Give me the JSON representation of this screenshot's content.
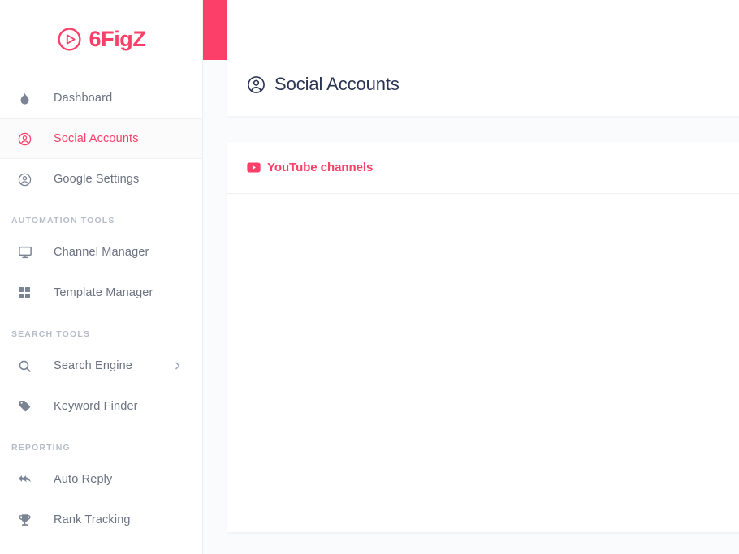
{
  "brand": {
    "name": "6FigZ",
    "logo_icon": "play-circle-icon"
  },
  "colors": {
    "accent": "#fb3f68",
    "title_text": "#2b3553",
    "nav_text": "#6b7280",
    "section_text": "#b6bcc7",
    "page_bg": "#fafbfc"
  },
  "topbar": {
    "menu_icon": "hamburger-icon"
  },
  "sidebar": {
    "groups": [
      {
        "section": null,
        "items": [
          {
            "label": "Dashboard",
            "icon": "flame-icon",
            "active": false,
            "has_arrow": false
          },
          {
            "label": "Social Accounts",
            "icon": "user-circle-icon",
            "active": true,
            "has_arrow": false
          },
          {
            "label": "Google Settings",
            "icon": "user-circle-icon",
            "active": false,
            "has_arrow": false
          }
        ]
      },
      {
        "section": "AUTOMATION TOOLS",
        "items": [
          {
            "label": "Channel Manager",
            "icon": "monitor-icon",
            "active": false,
            "has_arrow": false
          },
          {
            "label": "Template Manager",
            "icon": "grid-icon",
            "active": false,
            "has_arrow": false
          }
        ]
      },
      {
        "section": "SEARCH TOOLS",
        "items": [
          {
            "label": "Search Engine",
            "icon": "search-icon",
            "active": false,
            "has_arrow": true
          },
          {
            "label": "Keyword Finder",
            "icon": "tag-icon",
            "active": false,
            "has_arrow": false
          }
        ]
      },
      {
        "section": "REPORTING",
        "items": [
          {
            "label": "Auto Reply",
            "icon": "reply-all-icon",
            "active": false,
            "has_arrow": false
          },
          {
            "label": "Rank Tracking",
            "icon": "trophy-icon",
            "active": false,
            "has_arrow": false
          }
        ]
      }
    ]
  },
  "main": {
    "page_title": "Social Accounts",
    "page_title_icon": "user-circle-icon",
    "tabs": [
      {
        "label": "YouTube channels",
        "icon": "youtube-icon",
        "active": true
      }
    ]
  }
}
